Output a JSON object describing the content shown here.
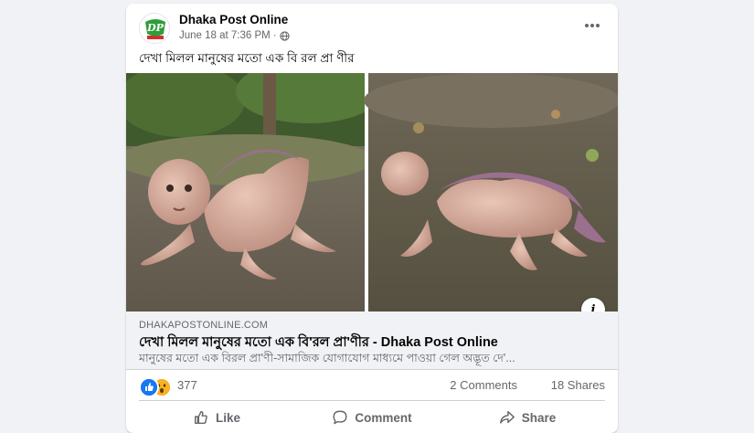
{
  "post": {
    "page_name": "Dhaka Post Online",
    "timestamp": "June 18 at 7:36 PM",
    "separator": "·",
    "privacy_icon": "globe-icon",
    "more_icon": "more-options-icon",
    "caption": "দেখা মিলল মানুষের মতো এক বি রল প্রা ণীর",
    "avatar_logo_text": "DP"
  },
  "link_preview": {
    "domain": "DHAKAPOSTONLINE.COM",
    "title": "দেখা মিলল মানুষের মতো এক বি'রল প্রা'ণীর - Dhaka Post Online",
    "description": "মানুষের মতো এক বিরল প্রা'ণী-সামাজিক যোগাযোগ মাধ্যমে পাওয়া গেল অদ্ভূত দে'...",
    "info_label": "i"
  },
  "stats": {
    "reaction_icons": [
      "like-reaction-icon",
      "wow-reaction-icon"
    ],
    "reaction_count": "377",
    "comments": "2 Comments",
    "shares": "18 Shares"
  },
  "actions": {
    "like": "Like",
    "comment": "Comment",
    "share": "Share"
  },
  "colors": {
    "background": "#f0f2f5",
    "card": "#ffffff",
    "secondary_text": "#65676b",
    "like_blue": "#1877f2",
    "wow_yellow": "#f7b125",
    "logo_green": "#2e9d3a",
    "logo_red": "#d32f2f"
  }
}
